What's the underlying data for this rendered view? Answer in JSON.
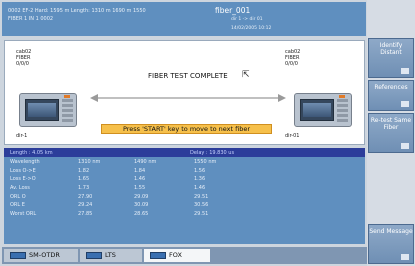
{
  "header": {
    "line1": "0002 EF-2    Hard: 1595 m   Length: 1310 m    1690 m  1550",
    "line2": "FIBER 1  IN 1 0002",
    "fiber_name": "fiber_001",
    "right_line1": "dir 1 -> dir 01",
    "right_line2": "14/02/2005 10:12"
  },
  "panel": {
    "title": "FIBER TEST COMPLETE",
    "left_labels": [
      "cab02",
      "FIBER",
      "0/0/0"
    ],
    "right_labels": [
      "cab02",
      "FIBER",
      "0/0/0"
    ],
    "left_id": "dir-1",
    "right_id": "dir-01",
    "start_message": "Press 'START' key to move to next fiber"
  },
  "summary": {
    "length": "Length : 4.05 km",
    "delay": "Delay : 19.830 us"
  },
  "results": {
    "rows": [
      [
        "Wavelength",
        "1310 nm",
        "1490 nm",
        "1550 nm"
      ],
      [
        "Loss O->E",
        "1.82",
        "1.84",
        "1.56"
      ],
      [
        "Loss E->O",
        "1.65",
        "1.46",
        "1.36"
      ],
      [
        "Av. Loss",
        "1.73",
        "1.55",
        "1.46"
      ],
      [
        "ORL O",
        "27.90",
        "29.09",
        "29.51"
      ],
      [
        "ORL E",
        "29.24",
        "30.09",
        "30.56"
      ],
      [
        "Worst ORL",
        "27.85",
        "28.65",
        "29.51"
      ]
    ]
  },
  "tabs": [
    {
      "label": "SM-OTDR",
      "active": false
    },
    {
      "label": "LTS",
      "active": false
    },
    {
      "label": "FOX",
      "active": true
    }
  ],
  "side_buttons": [
    {
      "label": "Identify Distant"
    },
    {
      "label": "References"
    },
    {
      "label": "Re-test Same Fiber"
    },
    {
      "label": "Send Message"
    }
  ]
}
